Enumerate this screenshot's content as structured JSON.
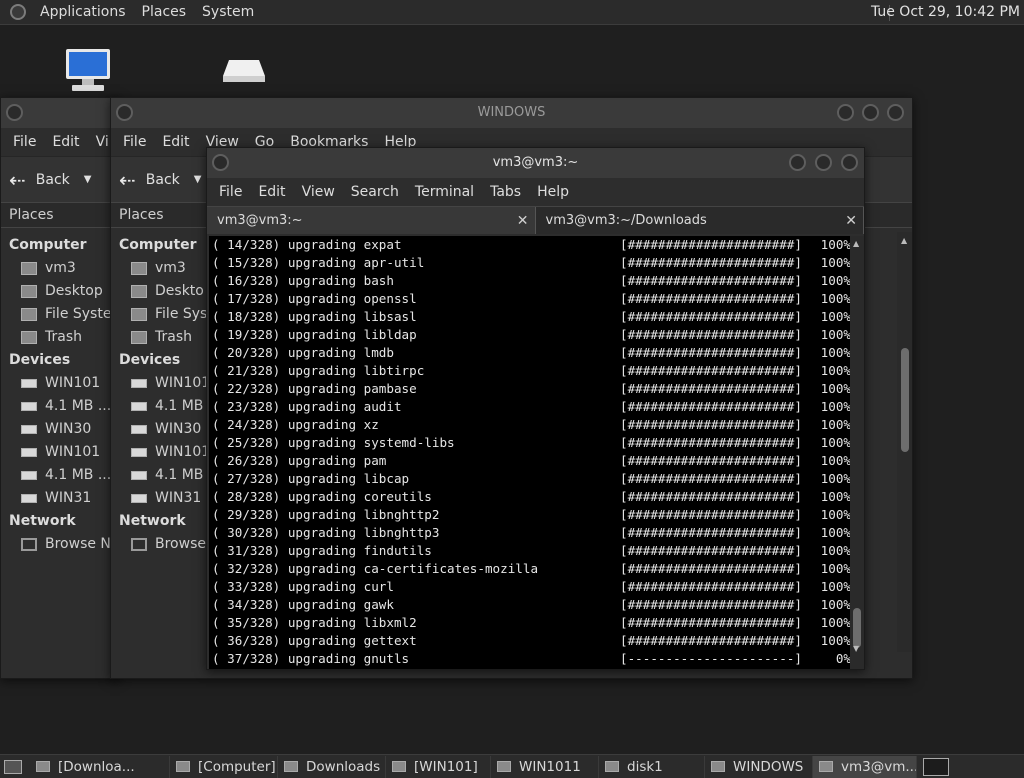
{
  "top_panel": {
    "menus": [
      "Applications",
      "Places",
      "System"
    ],
    "clock": "Tue Oct 29, 10:42 PM"
  },
  "browser_back": {
    "title": "",
    "menus": [
      "File",
      "Edit",
      "Vi"
    ],
    "back_label": "Back",
    "places_label": "Places",
    "sidebar": {
      "computer": "Computer",
      "computer_items": [
        "vm3",
        "Desktop",
        "File Syster",
        "Trash"
      ],
      "devices": "Devices",
      "device_items": [
        "WIN101",
        "4.1 MB ...",
        "WIN30",
        "WIN101",
        "4.1 MB ...",
        "WIN31"
      ],
      "network": "Network",
      "network_items": [
        "Browse Ne"
      ]
    }
  },
  "browser_front": {
    "title": "WINDOWS",
    "menus": [
      "File",
      "Edit",
      "View",
      "Go",
      "Bookmarks",
      "Help"
    ],
    "back_label": "Back",
    "places_label": "Places",
    "sidebar": {
      "computer": "Computer",
      "computer_items": [
        "vm3",
        "Deskto",
        "File Sys",
        "Trash"
      ],
      "devices": "Devices",
      "device_items": [
        "WIN101",
        "4.1 MB",
        "WIN30",
        "WIN101",
        "4.1 MB",
        "WIN31"
      ],
      "network": "Network",
      "network_items": [
        "Browse"
      ]
    }
  },
  "terminal": {
    "title": "vm3@vm3:~",
    "menus": [
      "File",
      "Edit",
      "View",
      "Search",
      "Terminal",
      "Tabs",
      "Help"
    ],
    "tabs": [
      "vm3@vm3:~",
      "vm3@vm3:~/Downloads"
    ],
    "close_glyph": "✕",
    "lines": [
      {
        "prefix": "( 14/328) upgrading expat",
        "bar": "[######################]",
        "pct": "100%"
      },
      {
        "prefix": "( 15/328) upgrading apr-util",
        "bar": "[######################]",
        "pct": "100%"
      },
      {
        "prefix": "( 16/328) upgrading bash",
        "bar": "[######################]",
        "pct": "100%"
      },
      {
        "prefix": "( 17/328) upgrading openssl",
        "bar": "[######################]",
        "pct": "100%"
      },
      {
        "prefix": "( 18/328) upgrading libsasl",
        "bar": "[######################]",
        "pct": "100%"
      },
      {
        "prefix": "( 19/328) upgrading libldap",
        "bar": "[######################]",
        "pct": "100%"
      },
      {
        "prefix": "( 20/328) upgrading lmdb",
        "bar": "[######################]",
        "pct": "100%"
      },
      {
        "prefix": "( 21/328) upgrading libtirpc",
        "bar": "[######################]",
        "pct": "100%"
      },
      {
        "prefix": "( 22/328) upgrading pambase",
        "bar": "[######################]",
        "pct": "100%"
      },
      {
        "prefix": "( 23/328) upgrading audit",
        "bar": "[######################]",
        "pct": "100%"
      },
      {
        "prefix": "( 24/328) upgrading xz",
        "bar": "[######################]",
        "pct": "100%"
      },
      {
        "prefix": "( 25/328) upgrading systemd-libs",
        "bar": "[######################]",
        "pct": "100%"
      },
      {
        "prefix": "( 26/328) upgrading pam",
        "bar": "[######################]",
        "pct": "100%"
      },
      {
        "prefix": "( 27/328) upgrading libcap",
        "bar": "[######################]",
        "pct": "100%"
      },
      {
        "prefix": "( 28/328) upgrading coreutils",
        "bar": "[######################]",
        "pct": "100%"
      },
      {
        "prefix": "( 29/328) upgrading libnghttp2",
        "bar": "[######################]",
        "pct": "100%"
      },
      {
        "prefix": "( 30/328) upgrading libnghttp3",
        "bar": "[######################]",
        "pct": "100%"
      },
      {
        "prefix": "( 31/328) upgrading findutils",
        "bar": "[######################]",
        "pct": "100%"
      },
      {
        "prefix": "( 32/328) upgrading ca-certificates-mozilla",
        "bar": "[######################]",
        "pct": "100%"
      },
      {
        "prefix": "( 33/328) upgrading curl",
        "bar": "[######################]",
        "pct": "100%"
      },
      {
        "prefix": "( 34/328) upgrading gawk",
        "bar": "[######################]",
        "pct": "100%"
      },
      {
        "prefix": "( 35/328) upgrading libxml2",
        "bar": "[######################]",
        "pct": "100%"
      },
      {
        "prefix": "( 36/328) upgrading gettext",
        "bar": "[######################]",
        "pct": "100%"
      },
      {
        "prefix": "( 37/328) upgrading gnutls",
        "bar": "[----------------------]",
        "pct": "0%"
      }
    ]
  },
  "taskbar": [
    "[Downloa...",
    "[Computer]",
    "Downloads",
    "[WIN101]",
    "WIN1011",
    "disk1",
    "WINDOWS",
    "vm3@vm..."
  ],
  "colors": {
    "desktop": "#1f1f1f",
    "panel": "#2b2b2b",
    "window": "#2d2d2d",
    "terminal_bg": "#000000",
    "terminal_fg": "#e6e6e6"
  }
}
